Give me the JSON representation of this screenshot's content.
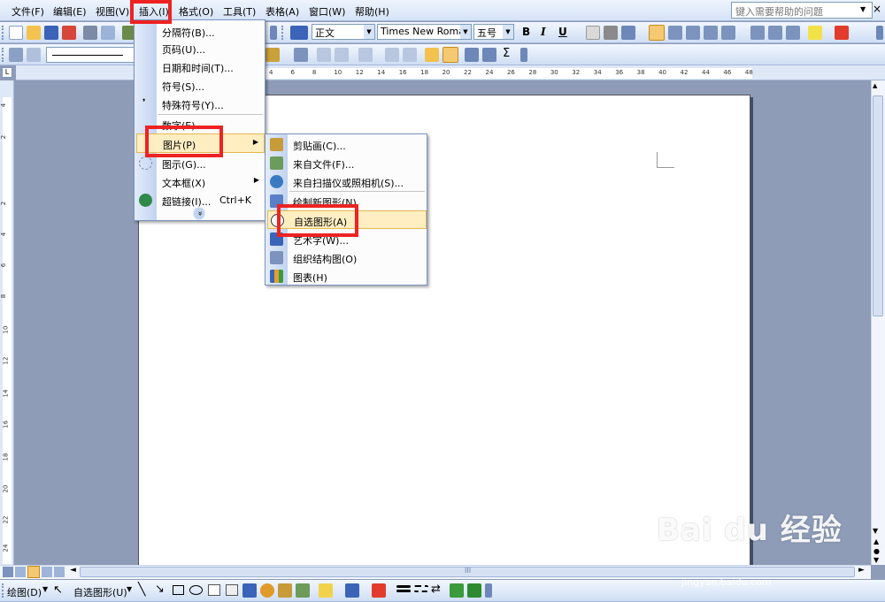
{
  "menubar": {
    "items": [
      {
        "label": "文件(F)",
        "key": "file"
      },
      {
        "label": "编辑(E)",
        "key": "edit"
      },
      {
        "label": "视图(V)",
        "key": "view"
      },
      {
        "label": "插入(I)",
        "key": "insert"
      },
      {
        "label": "格式(O)",
        "key": "format"
      },
      {
        "label": "工具(T)",
        "key": "tools"
      },
      {
        "label": "表格(A)",
        "key": "table"
      },
      {
        "label": "窗口(W)",
        "key": "window"
      },
      {
        "label": "帮助(H)",
        "key": "help"
      }
    ],
    "help_placeholder": "键入需要帮助的问题",
    "close_glyph": "×"
  },
  "formatting": {
    "style": "正文",
    "font": "Times New Roman",
    "size": "五号",
    "bold": "B",
    "italic": "I",
    "underline": "U",
    "autosum": "Σ"
  },
  "ruler_numbers": [
    "4",
    "6",
    "8",
    "10",
    "12",
    "14",
    "16",
    "18",
    "20",
    "22",
    "24",
    "26",
    "28",
    "30",
    "32",
    "34",
    "36",
    "38",
    "40",
    "42",
    "44",
    "46",
    "48"
  ],
  "vruler_numbers": [
    "4",
    "2",
    "2",
    "4",
    "6",
    "8",
    "10",
    "12",
    "14",
    "16",
    "18",
    "20",
    "22",
    "24"
  ],
  "insert_menu": {
    "items": [
      {
        "label": "分隔符(B)..."
      },
      {
        "label": "页码(U)..."
      },
      {
        "label": "日期和时间(T)..."
      },
      {
        "label": "符号(S)..."
      },
      {
        "label": "特殊符号(Y)..."
      },
      {
        "label": "数字(E)..."
      },
      {
        "label": "图片(P)"
      },
      {
        "label": "图示(G)..."
      },
      {
        "label": "文本框(X)"
      },
      {
        "label": "超链接(I)...",
        "shortcut": "Ctrl+K"
      }
    ],
    "expand_glyph": "»"
  },
  "picture_submenu": {
    "items": [
      {
        "label": "剪贴画(C)..."
      },
      {
        "label": "来自文件(F)..."
      },
      {
        "label": "来自扫描仪或照相机(S)..."
      },
      {
        "label": "绘制新图形(N)"
      },
      {
        "label": "自选图形(A)"
      },
      {
        "label": "艺术字(W)..."
      },
      {
        "label": "组织结构图(O)"
      },
      {
        "label": "图表(H)"
      }
    ]
  },
  "drawbar": {
    "draw_label": "绘图(D)",
    "autoshapes_label": "自选图形(U)"
  },
  "scroll_center": "III",
  "watermark": {
    "brand": "Bai du 经验",
    "url": "jingyan.baidu.com"
  },
  "colors": {
    "highlight_box": "#ee2222",
    "menu_highlight": "#ffeec2",
    "workspace": "#8e9cb8"
  }
}
